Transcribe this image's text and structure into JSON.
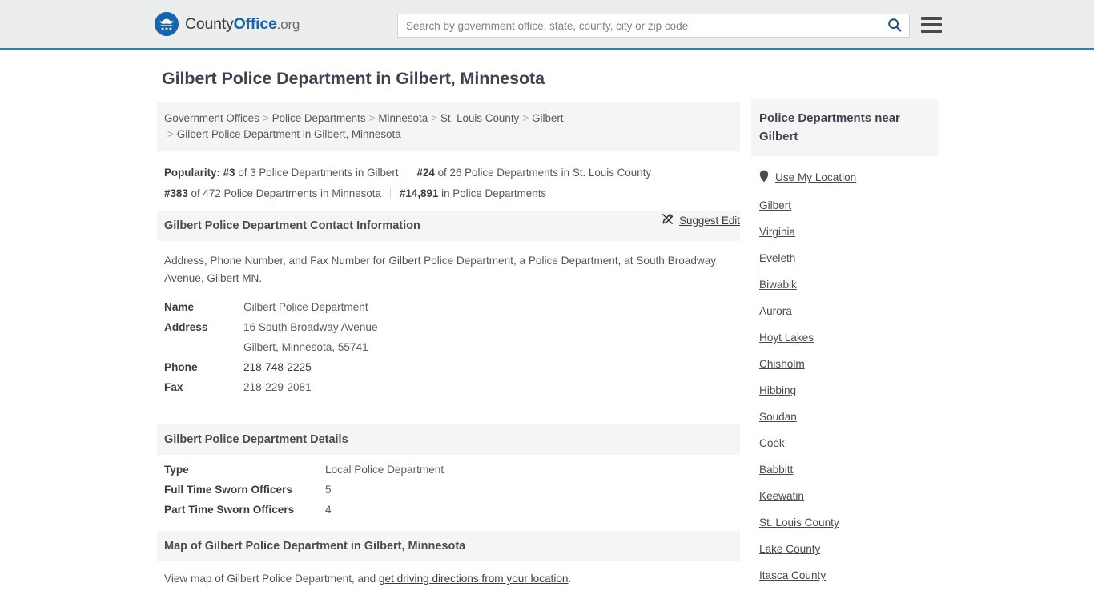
{
  "header": {
    "logo": {
      "text_1": "County",
      "text_2": "Office",
      "text_3": ".org",
      "icon": "eagle-seal-icon"
    },
    "search": {
      "placeholder": "Search by government office, state, county, city or zip code",
      "value": "",
      "icon": "search-icon"
    },
    "menu_icon": "hamburger-menu-icon",
    "accent_color": "#3f77a8",
    "background": "#eceded"
  },
  "main": {
    "page_title": "Gilbert Police Department in Gilbert, Minnesota",
    "breadcrumb": {
      "separator": ">",
      "items": [
        "Government Offices",
        "Police Departments",
        "Minnesota",
        "St. Louis County",
        "Gilbert"
      ],
      "current": "Gilbert Police Department in Gilbert, Minnesota"
    },
    "popularity": {
      "label": "Popularity:",
      "items": [
        {
          "rank": "#3",
          "rest": "of 3 Police Departments in Gilbert"
        },
        {
          "rank": "#24",
          "rest": "of 26 Police Departments in St. Louis County"
        },
        {
          "rank": "#383",
          "rest": "of 472 Police Departments in Minnesota"
        },
        {
          "rank": "#14,891",
          "rest": "in Police Departments"
        }
      ]
    },
    "contact": {
      "heading": "Gilbert Police Department Contact Information",
      "description": "Address, Phone Number, and Fax Number for Gilbert Police Department, a Police Department, at South Broadway Avenue, Gilbert MN.",
      "suggest_edit": {
        "label": "Suggest Edit",
        "icon": "pencil-edit-icon"
      },
      "rows": [
        {
          "label": "Name",
          "value": "Gilbert Police Department"
        },
        {
          "label": "Address",
          "value": "16 South Broadway Avenue"
        },
        {
          "label": "",
          "value": "Gilbert, Minnesota, 55741"
        },
        {
          "label": "Phone",
          "value": "218-748-2225"
        },
        {
          "label": "Fax",
          "value": "218-229-2081"
        }
      ]
    },
    "details": {
      "heading": "Gilbert Police Department Details",
      "rows": [
        {
          "label": "Type",
          "value": "Local Police Department"
        },
        {
          "label": "Full Time Sworn Officers",
          "value": "5"
        },
        {
          "label": "Part Time Sworn Officers",
          "value": "4"
        }
      ]
    },
    "map": {
      "heading": "Map of Gilbert Police Department in Gilbert, Minnesota",
      "note_prefix": "View map of Gilbert Police Department, and ",
      "note_link": "get driving directions from your location",
      "note_suffix": "."
    }
  },
  "sidebar": {
    "heading": "Police Departments near Gilbert",
    "use_my_location": {
      "label": "Use My Location",
      "icon": "map-pin-icon"
    },
    "items": [
      "Gilbert",
      "Virginia",
      "Eveleth",
      "Biwabik",
      "Aurora",
      "Hoyt Lakes",
      "Chisholm",
      "Hibbing",
      "Soudan",
      "Cook",
      "Babbitt",
      "Keewatin",
      "St. Louis County",
      "Lake County",
      "Itasca County"
    ]
  }
}
